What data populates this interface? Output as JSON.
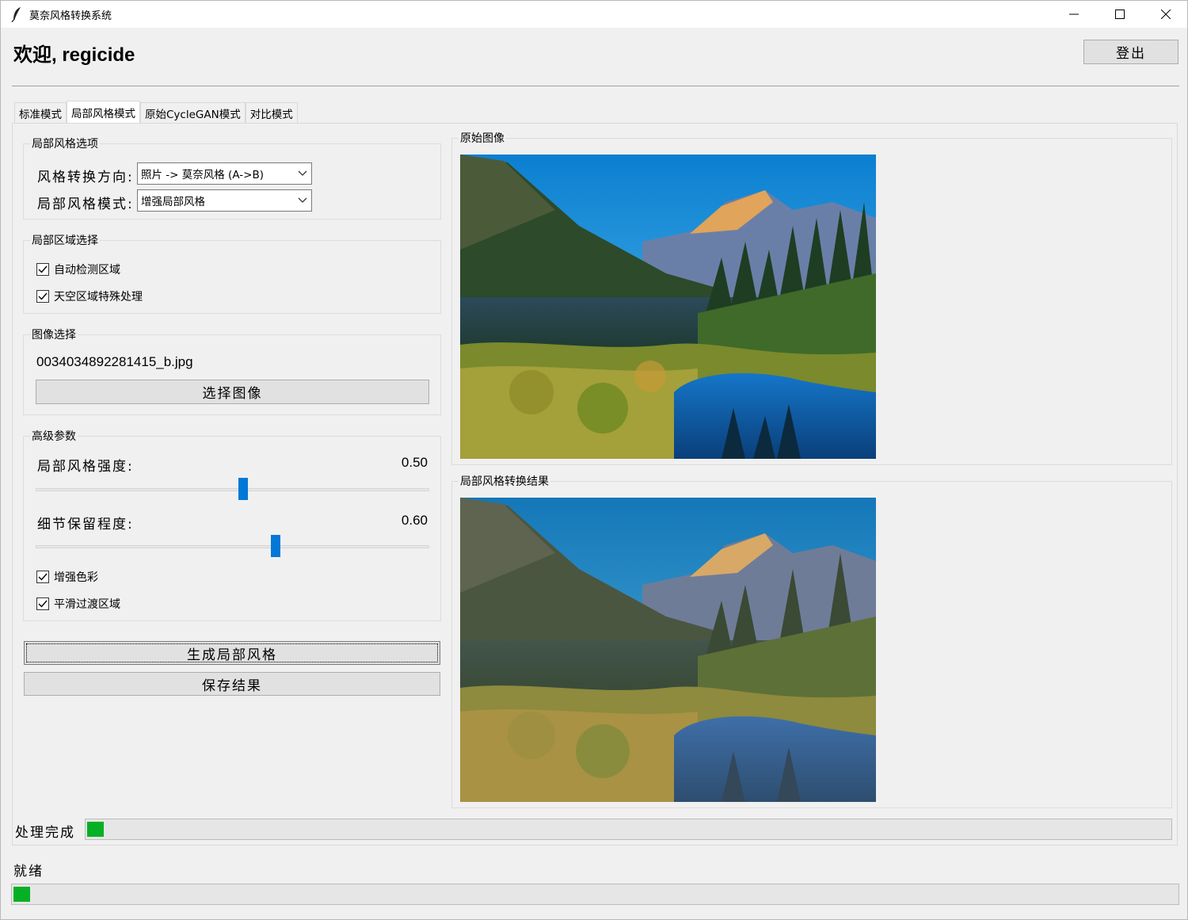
{
  "window": {
    "title": "莫奈风格转换系统",
    "icons": [
      "feather-icon",
      "minimize-icon",
      "maximize-icon",
      "close-icon"
    ]
  },
  "header": {
    "welcome": "欢迎, regicide",
    "logout_label": "登出"
  },
  "tabs": [
    {
      "label": "标准模式",
      "active": false
    },
    {
      "label": "局部风格模式",
      "active": true
    },
    {
      "label": "原始CycleGAN模式",
      "active": false
    },
    {
      "label": "对比模式",
      "active": false
    }
  ],
  "local_options": {
    "title": "局部风格选项",
    "direction_label": "风格转换方向:",
    "direction_value": "照片 -> 莫奈风格 (A->B)",
    "mode_label": "局部风格模式:",
    "mode_value": "增强局部风格"
  },
  "region": {
    "title": "局部区域选择",
    "auto_detect": {
      "label": "自动检测区域",
      "checked": true
    },
    "sky_special": {
      "label": "天空区域特殊处理",
      "checked": true
    }
  },
  "image_select": {
    "title": "图像选择",
    "filename": "0034034892281415_b.jpg",
    "button_label": "选择图像"
  },
  "advanced": {
    "title": "高级参数",
    "strength_label": "局部风格强度:",
    "strength_value": "0.50",
    "strength": 0.5,
    "detail_label": "细节保留程度:",
    "detail_value": "0.60",
    "detail": 0.6,
    "enhance_color": {
      "label": "增强色彩",
      "checked": true
    },
    "smooth_transition": {
      "label": "平滑过渡区域",
      "checked": true
    }
  },
  "actions": {
    "generate_label": "生成局部风格",
    "save_label": "保存结果"
  },
  "images": {
    "original_title": "原始图像",
    "result_title": "局部风格转换结果"
  },
  "status": {
    "processing_text": "处理完成",
    "processing_progress": 0.015,
    "main_status": "就绪",
    "main_progress": 0.014
  },
  "colors": {
    "accent": "#0078d7",
    "progress": "#06b025"
  }
}
